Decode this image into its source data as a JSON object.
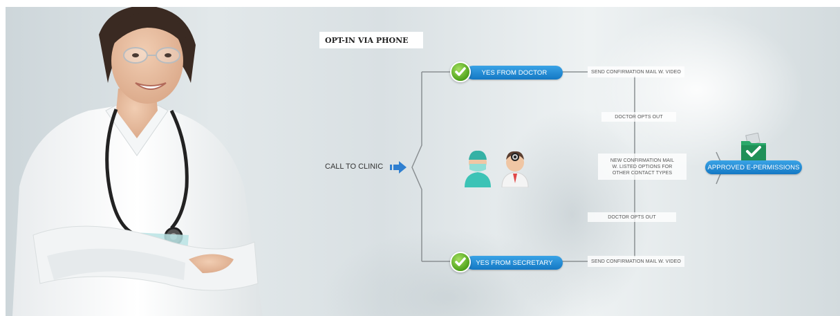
{
  "diagram": {
    "title": "OPT-IN VIA PHONE",
    "start_label": "CALL TO CLINIC",
    "branches": {
      "top": "YES FROM DOCTOR",
      "bottom": "YES FROM SECRETARY"
    },
    "notes": {
      "send_top": "SEND CONFIRMATION MAIL W. VIDEO",
      "opts_out_top": "DOCTOR OPTS OUT",
      "new_mail_line1": "NEW CONFIRMATION MAIL",
      "new_mail_line2": "W. LISTED OPTIONS FOR",
      "new_mail_line3": "OTHER CONTACT TYPES",
      "opts_out_bottom": "DOCTOR OPTS OUT",
      "send_bottom": "SEND CONFIRMATION MAIL W. VIDEO"
    },
    "result": "APPROVED E-PERMISSIONS"
  },
  "colors": {
    "accent_blue": "#1e88d6",
    "check_green": "#5cb82a",
    "connector_gray": "#8a8f92"
  },
  "icons": [
    "nurse-photo",
    "arrow-right-icon",
    "check-icon",
    "surgeon-icon",
    "doctor-icon",
    "folder-check-icon"
  ]
}
